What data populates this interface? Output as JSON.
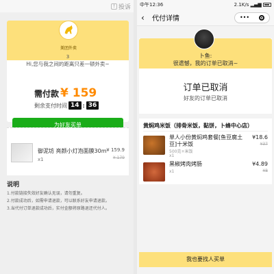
{
  "left": {
    "report_label": "投诉",
    "brand_name": "美团外卖",
    "count": "3",
    "distance_text": "Hi,您与我之间的距离只差一顿外卖~",
    "pay_label": "需付款",
    "pay_amount": "¥ 159",
    "countdown_label": "剩余支付时间",
    "countdown_min": "14",
    "countdown_sep": ":",
    "countdown_sec": "36",
    "pay_button": "为好友买单",
    "order": {
      "name": "御泥坊 亮颜小灯泡面膜30ml*...",
      "qty": "x1",
      "price": "¥ 159.9",
      "orig": "¥ 179"
    },
    "notes": {
      "title": "说明",
      "items": [
        "1.付款链接失效好友确认无误，请勿重复。",
        "2.付款成功后，如需申请退款，可以联系好友申请退款。",
        "3.当代付订单退款成功后，实付金额将原路退还代付人。"
      ]
    }
  },
  "right": {
    "statusbar": {
      "time": "中午12:36",
      "signal": "2.1K/s"
    },
    "navbar": {
      "back": "‹",
      "title": "代付详情",
      "more": "•••"
    },
    "user_name": "卜鱼:",
    "message": "很遗憾，我的订单已取消~",
    "status": "订单已取消",
    "sub_status": "好友的订单已取消",
    "store": "黄焖鸡米饭（排骨米饭，黏饼，卜蜂中心店）",
    "items": [
      {
        "name": "单人小份黄焖鸡套餐[鱼豆腐土豆]十米饭",
        "spec": "500克+米饭",
        "qty": "x1",
        "price": "¥18.6",
        "orig": "¥37"
      },
      {
        "name": "黑椒烤肉烤肠",
        "spec": "",
        "qty": "x1",
        "price": "¥4.89",
        "orig": "¥8"
      }
    ],
    "bottom_button": "我也要找人买单"
  },
  "colors": {
    "brand_yellow": "#fde07b",
    "accent_orange": "#ff8a00",
    "wechat_green": "#1aad19"
  }
}
